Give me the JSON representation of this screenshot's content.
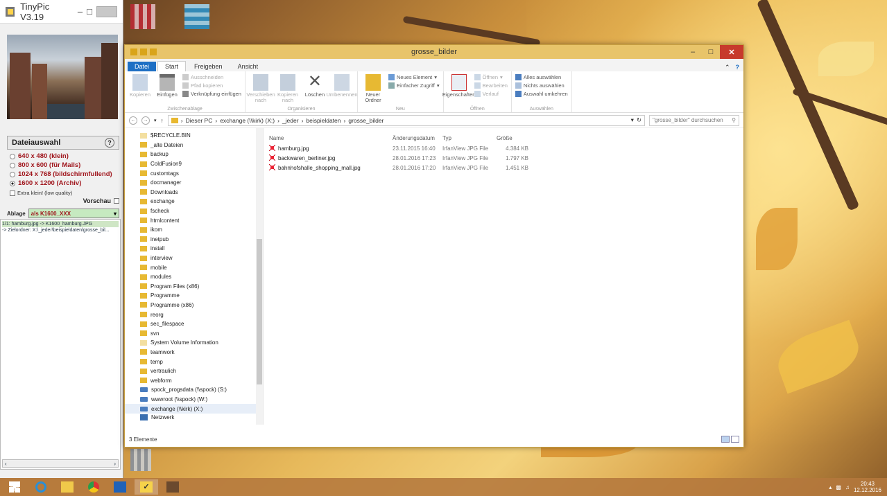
{
  "tinypic": {
    "title": "TinyPic V3.19",
    "panel_title": "Dateiauswahl",
    "help_label": "?",
    "sizes": [
      {
        "label": "640 x 480 (klein)",
        "selected": false
      },
      {
        "label": "800 x 600 (für Mails)",
        "selected": false
      },
      {
        "label": "1024 x 768 (bildschirmfullend)",
        "selected": false
      },
      {
        "label": "1600 x 1200 (Archiv)",
        "selected": true
      }
    ],
    "extra_label": "Extra klein! (low quality)",
    "vorschau_label": "Vorschau",
    "ablage_label": "Ablage",
    "ablage_value": "als K1600_XXX",
    "log": [
      "1/1: hamburg.jpg -> K1600_hamburg.JPG",
      "-> Zielordner: X:\\_jeder\\beispieldaten\\grosse_bil..."
    ]
  },
  "explorer": {
    "title": "grosse_bilder",
    "tabs": [
      "Datei",
      "Start",
      "Freigeben",
      "Ansicht"
    ],
    "ribbon": {
      "clipboard": {
        "label": "Zwischenablage",
        "copy": "Kopieren",
        "paste": "Einfügen",
        "cut": "Ausschneiden",
        "copy_path": "Pfad kopieren",
        "paste_shortcut": "Verknüpfung einfügen"
      },
      "organize": {
        "label": "Organisieren",
        "move": "Verschieben nach",
        "copy_to": "Kopieren nach",
        "delete": "Löschen",
        "rename": "Umbenennen"
      },
      "new": {
        "label": "Neu",
        "new_folder": "Neuer Ordner",
        "new_item": "Neues Element",
        "easy_access": "Einfacher Zugriff"
      },
      "open": {
        "label": "Öffnen",
        "properties": "Eigenschaften",
        "open": "Öffnen",
        "edit": "Bearbeiten",
        "history": "Verlauf"
      },
      "select": {
        "label": "Auswählen",
        "select_all": "Alles auswählen",
        "select_none": "Nichts auswählen",
        "invert": "Auswahl umkehren"
      }
    },
    "breadcrumb": [
      "Dieser PC",
      "exchange (\\\\kirk) (X:)",
      "_jeder",
      "beispieldaten",
      "grosse_bilder"
    ],
    "search_placeholder": "\"grosse_bilder\" durchsuchen",
    "nav_items": [
      {
        "label": "$RECYCLE.BIN",
        "pale": true
      },
      {
        "label": "_alte Dateien",
        "pale": false
      },
      {
        "label": "backup",
        "pale": false
      },
      {
        "label": "ColdFusion9",
        "pale": false
      },
      {
        "label": "customtags",
        "pale": false
      },
      {
        "label": "docmanager",
        "pale": false
      },
      {
        "label": "Downloads",
        "pale": false
      },
      {
        "label": "exchange",
        "pale": false
      },
      {
        "label": "fscheck",
        "pale": false
      },
      {
        "label": "htmlcontent",
        "pale": false
      },
      {
        "label": "ikom",
        "pale": false
      },
      {
        "label": "inetpub",
        "pale": false
      },
      {
        "label": "install",
        "pale": false
      },
      {
        "label": "interview",
        "pale": false
      },
      {
        "label": "mobile",
        "pale": false
      },
      {
        "label": "modules",
        "pale": false
      },
      {
        "label": "Program Files (x86)",
        "pale": false
      },
      {
        "label": "Programme",
        "pale": false
      },
      {
        "label": "Programme (x86)",
        "pale": false
      },
      {
        "label": "reorg",
        "pale": false
      },
      {
        "label": "sec_filespace",
        "pale": false
      },
      {
        "label": "svn",
        "pale": false
      },
      {
        "label": "System Volume Information",
        "pale": true
      },
      {
        "label": "teamwork",
        "pale": false
      },
      {
        "label": "temp",
        "pale": false
      },
      {
        "label": "vertraulich",
        "pale": false
      },
      {
        "label": "webform",
        "pale": false
      }
    ],
    "drives": [
      {
        "label": "spock_progsdata (\\\\spock) (S:)",
        "selected": false
      },
      {
        "label": "wwwroot (\\\\spock) (W:)",
        "selected": false
      },
      {
        "label": "exchange (\\\\kirk) (X:)",
        "selected": true
      }
    ],
    "network_label": "Netzwerk",
    "columns": [
      "Name",
      "Änderungsdatum",
      "Typ",
      "Größe"
    ],
    "files": [
      {
        "name": "hamburg.jpg",
        "date": "23.11.2015 16:40",
        "type": "IrfanView JPG File",
        "size": "4.384 KB"
      },
      {
        "name": "backwaren_berliner.jpg",
        "date": "28.01.2016 17:23",
        "type": "IrfanView JPG File",
        "size": "1.797 KB"
      },
      {
        "name": "bahnhofshalle_shopping_mall.jpg",
        "date": "28.01.2016 17:20",
        "type": "IrfanView JPG File",
        "size": "1.451 KB"
      }
    ],
    "status": "3 Elemente"
  },
  "taskbar": {
    "time": "20:43",
    "date": "12.12.2016"
  },
  "colors": {
    "file_tab": "#1e6fc4",
    "close": "#c73a2c",
    "size_text": "#a0161d",
    "ablage_bg": "#c6eac0"
  },
  "icons": [
    "windows-logo-icon",
    "internet-explorer-icon",
    "file-explorer-icon",
    "chrome-icon",
    "outlook-icon",
    "checkmark-app-icon",
    "photo-app-icon"
  ]
}
